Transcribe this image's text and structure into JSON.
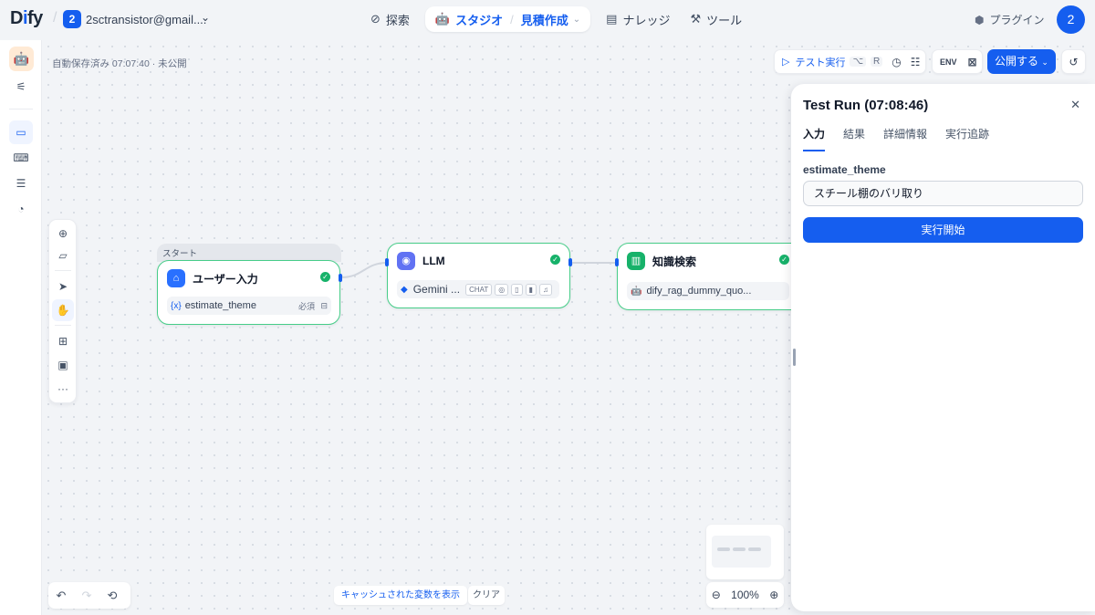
{
  "header": {
    "logo": "Dify",
    "workspace_badge": "2",
    "workspace_name": "2sctransistor@gmail....",
    "nav": {
      "explore": "探索",
      "studio": "スタジオ",
      "app_name": "見積作成",
      "knowledge": "ナレッジ",
      "tools": "ツール"
    },
    "plugins": "プラグイン",
    "avatar": "2"
  },
  "canvas": {
    "autosave": "自動保存済み 07:07:40 · 未公開",
    "test_run": "テスト実行",
    "test_run_shortcut": [
      "⌥",
      "R"
    ],
    "env": "ENV",
    "publish": "公開する",
    "nodes": {
      "start_label": "スタート",
      "user_input": {
        "title": "ユーザー入力",
        "var": "estimate_theme",
        "required": "必須"
      },
      "llm": {
        "title": "LLM",
        "model": "Gemini ...",
        "tag": "CHAT"
      },
      "knowledge": {
        "title": "知識検索",
        "dataset": "dify_rag_dummy_quo..."
      }
    },
    "zoom": "100%",
    "cache_button": "キャッシュされた変数を表示",
    "clear_button": "クリア"
  },
  "panel": {
    "title": "Test Run (07:08:46)",
    "tabs": [
      "入力",
      "結果",
      "詳細情報",
      "実行追跡"
    ],
    "field_label": "estimate_theme",
    "field_value": "スチール棚のバリ取り",
    "run_button": "実行開始"
  },
  "colors": {
    "primary": "#155eef",
    "success": "#17b26a",
    "node_border": "#47cd89"
  }
}
